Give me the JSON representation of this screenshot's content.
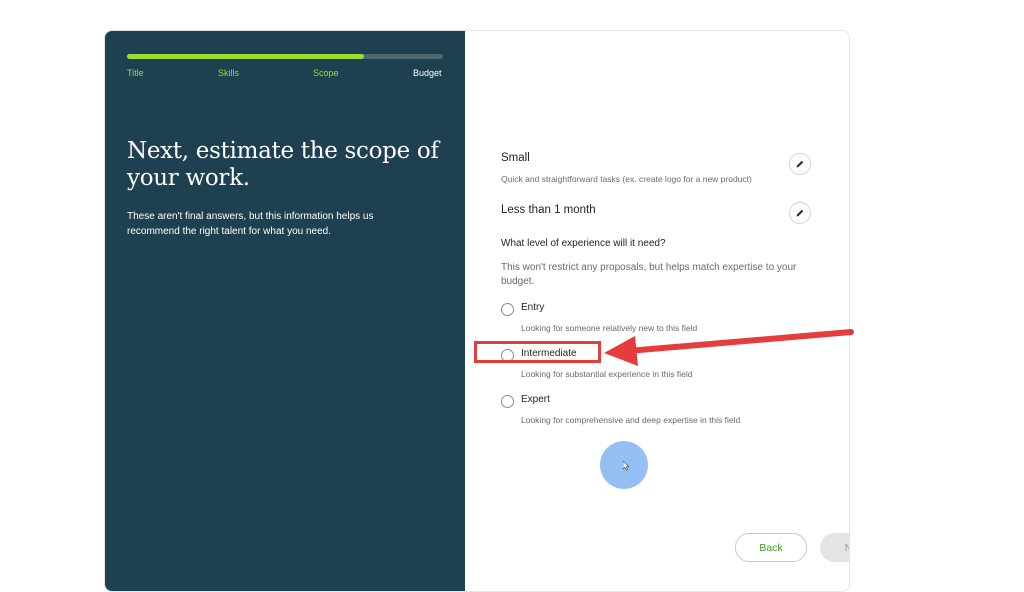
{
  "progress": {
    "percent": 75,
    "steps": [
      {
        "label": "Title",
        "state": "done"
      },
      {
        "label": "Skills",
        "state": "done"
      },
      {
        "label": "Scope",
        "state": "current"
      },
      {
        "label": "Budget",
        "state": "upcoming"
      }
    ]
  },
  "hero": {
    "title": "Next, estimate the scope of your work.",
    "subtitle": "These aren't final answers, but this information helps us recommend the right talent for what you need."
  },
  "summary": [
    {
      "title": "Small",
      "description": "Quick and straightforward tasks (ex. create logo for a new product)"
    },
    {
      "title": "Less than 1 month",
      "description": ""
    }
  ],
  "experience": {
    "question": "What level of experience will it need?",
    "description": "This won't restrict any proposals, but helps match expertise to your budget.",
    "options": [
      {
        "label": "Entry",
        "help": "Looking for someone relatively new to this field"
      },
      {
        "label": "Intermediate",
        "help": "Looking for substantial experience in this field"
      },
      {
        "label": "Expert",
        "help": "Looking for comprehensive and deep expertise in this field"
      }
    ]
  },
  "buttons": {
    "back": "Back",
    "next": "Next: Budget"
  },
  "colors": {
    "panel": "#1f4050",
    "accent": "#9cde2f",
    "annotation": "#e53c3c",
    "cursor": "#8fbcf5"
  }
}
